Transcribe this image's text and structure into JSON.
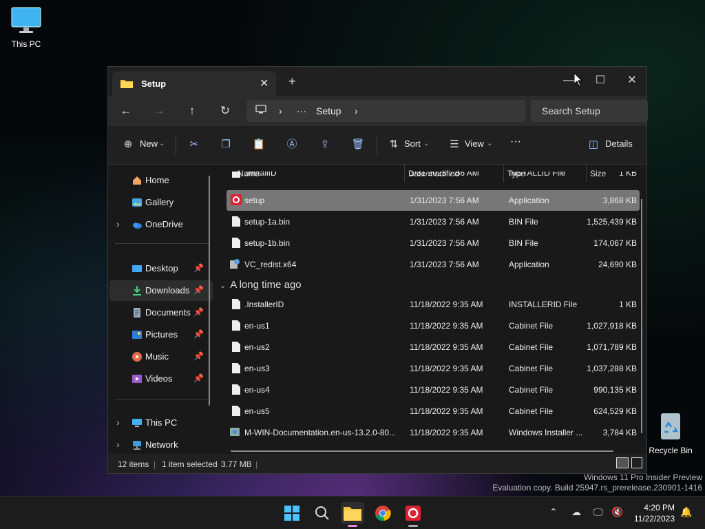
{
  "desktop": {
    "icons": [
      {
        "label": "This PC"
      },
      {
        "label": "Recycle Bin"
      }
    ],
    "watermark": [
      "Windows 11 Pro Insider Preview",
      "Evaluation copy. Build 25947.rs_prerelease.230901-1416"
    ]
  },
  "window": {
    "tab_title": "Setup",
    "close_glyph": "✕",
    "newtab_glyph": "+",
    "controls": {
      "min": "—",
      "max": "☐",
      "close": "✕"
    }
  },
  "nav": {
    "back": "←",
    "forward": "→",
    "up": "↑",
    "refresh": "↻",
    "address": {
      "crumb_sep1": "›",
      "ellipsis": "···",
      "folder": "Setup",
      "crumb_sep2": "›"
    },
    "search_placeholder": "Search Setup"
  },
  "toolbar": {
    "new_label": "New",
    "sort_label": "Sort",
    "view_label": "View",
    "more": "···",
    "details_label": "Details"
  },
  "sidebar": {
    "home": "Home",
    "gallery": "Gallery",
    "onedrive": "OneDrive",
    "desktop": "Desktop",
    "downloads": "Downloads",
    "documents": "Documents",
    "pictures": "Pictures",
    "music": "Music",
    "videos": "Videos",
    "thispc": "This PC",
    "network": "Network"
  },
  "columns": {
    "name": "Name",
    "date": "Date modified",
    "type": "Type",
    "size": "Size"
  },
  "files_recent": [
    {
      "name": ".InstallID",
      "date": "1/31/2023 7:56 AM",
      "type": "INSTALLID File",
      "size": "1 KB"
    },
    {
      "name": "setup",
      "date": "1/31/2023 7:56 AM",
      "type": "Application",
      "size": "3,868 KB"
    },
    {
      "name": "setup-1a.bin",
      "date": "1/31/2023 7:56 AM",
      "type": "BIN File",
      "size": "1,525,439 KB"
    },
    {
      "name": "setup-1b.bin",
      "date": "1/31/2023 7:56 AM",
      "type": "BIN File",
      "size": "174,067 KB"
    },
    {
      "name": "VC_redist.x64",
      "date": "1/31/2023 7:56 AM",
      "type": "Application",
      "size": "24,690 KB"
    }
  ],
  "group_label": "A long time ago",
  "files_old": [
    {
      "name": ".InstallerID",
      "date": "11/18/2022 9:35 AM",
      "type": "INSTALLERID File",
      "size": "1 KB"
    },
    {
      "name": "en-us1",
      "date": "11/18/2022 9:35 AM",
      "type": "Cabinet File",
      "size": "1,027,918 KB"
    },
    {
      "name": "en-us2",
      "date": "11/18/2022 9:35 AM",
      "type": "Cabinet File",
      "size": "1,071,789 KB"
    },
    {
      "name": "en-us3",
      "date": "11/18/2022 9:35 AM",
      "type": "Cabinet File",
      "size": "1,037,288 KB"
    },
    {
      "name": "en-us4",
      "date": "11/18/2022 9:35 AM",
      "type": "Cabinet File",
      "size": "990,135 KB"
    },
    {
      "name": "en-us5",
      "date": "11/18/2022 9:35 AM",
      "type": "Cabinet File",
      "size": "624,529 KB"
    },
    {
      "name": "M-WIN-Documentation.en-us-13.2.0-80...",
      "date": "11/18/2022 9:35 AM",
      "type": "Windows Installer ...",
      "size": "3,784 KB"
    }
  ],
  "status": {
    "items": "12 items",
    "selected": "1 item selected",
    "size": "3.77 MB"
  },
  "clock": {
    "time": "4:20 PM",
    "date": "11/22/2023"
  },
  "colors": {
    "accent": "#4cc2ff",
    "selection": "#777777"
  }
}
